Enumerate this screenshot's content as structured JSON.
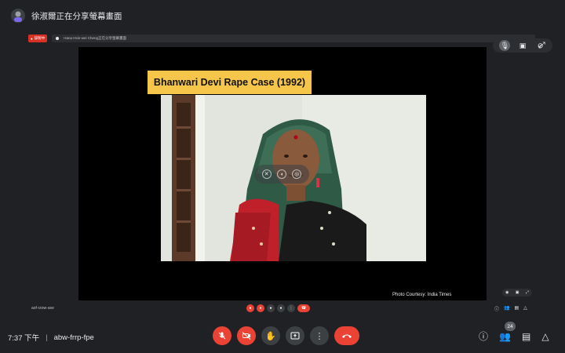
{
  "banner": {
    "title": "徐淑爾正在分享螢幕畫面"
  },
  "inner_strip": {
    "rec_label": "錄製中",
    "presenter_text": "Hana Hsin-wei Cheng正在分享螢幕畫面"
  },
  "slide": {
    "title": "Bhanwari Devi Rape Case (1992)",
    "photo_credit": "Photo Courtesy: India Times"
  },
  "inner_meeting": {
    "code": "aof-rzow-axe"
  },
  "meeting": {
    "time": "7:37 下午",
    "separator": "|",
    "code": "abw-frrp-fpe",
    "participant_count": "24"
  },
  "icons": {
    "mic_off": "🎙",
    "cam_off": "▣",
    "hand": "✋",
    "present": "⇧",
    "more": "⋮",
    "end_call": "☎",
    "info": "ⓘ",
    "people": "👥",
    "chat": "▤",
    "activities": "△",
    "expand": "⤢",
    "hide": "⊘"
  },
  "colors": {
    "background": "#202124",
    "end_call_red": "#ea4335",
    "title_yellow": "#f5c64a",
    "control_gray": "#3c4043"
  }
}
